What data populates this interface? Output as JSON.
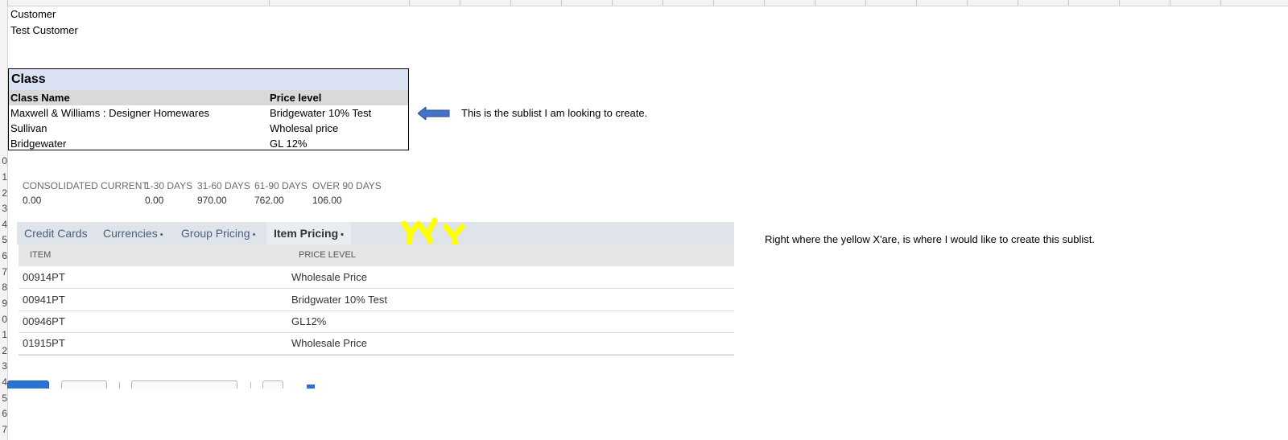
{
  "sheet": {
    "row_numbers": [
      "",
      "",
      "",
      "",
      "",
      "",
      "",
      "",
      "",
      "0",
      "1",
      "2",
      "3",
      "4",
      "5",
      "6",
      "7",
      "8",
      "9",
      "0",
      "1",
      "2",
      "3",
      "4",
      "5",
      "6",
      "7"
    ]
  },
  "customer": {
    "label": "Customer",
    "value": "Test Customer"
  },
  "class_table": {
    "title": "Class",
    "headers": [
      "Class Name",
      "Price level"
    ],
    "rows": [
      [
        "Maxwell & Williams : Designer Homewares",
        "Bridgewater 10% Test"
      ],
      [
        "Sullivan",
        "Wholesal price"
      ],
      [
        "Bridgewater",
        "GL 12%"
      ]
    ]
  },
  "annotations": {
    "arrow_note": "This is the sublist I am looking to create.",
    "yellow_note": "Right where the yellow X'are, is where I would like to create this sublist.",
    "arrow_color": "#4472c4",
    "mark_color": "#ffff00"
  },
  "aging": {
    "columns": [
      {
        "label": "CONSOLIDATED CURRENT",
        "value": "0.00"
      },
      {
        "label": "1-30 DAYS",
        "value": "0.00"
      },
      {
        "label": "31-60 DAYS",
        "value": "970.00"
      },
      {
        "label": "61-90 DAYS",
        "value": "762.00"
      },
      {
        "label": "OVER 90 DAYS",
        "value": "106.00"
      }
    ]
  },
  "sublist": {
    "tabs": [
      {
        "label": "Credit Cards",
        "dot": ""
      },
      {
        "label": "Currencies",
        "dot": "•"
      },
      {
        "label": "Group Pricing",
        "dot": "•"
      },
      {
        "label": "Item Pricing",
        "dot": "•",
        "active": true
      }
    ],
    "headers": [
      "ITEM",
      "PRICE LEVEL"
    ],
    "rows": [
      [
        "00914PT",
        "Wholesale Price"
      ],
      [
        "00941PT",
        "Bridgwater 10% Test"
      ],
      [
        "00946PT",
        "GL12%"
      ],
      [
        "01915PT",
        "Wholesale Price"
      ]
    ]
  },
  "colors": {
    "class_title_bg": "#d9e1f2",
    "tabbar_bg": "#dfe4eb",
    "primary_button": "#2a72d4"
  }
}
